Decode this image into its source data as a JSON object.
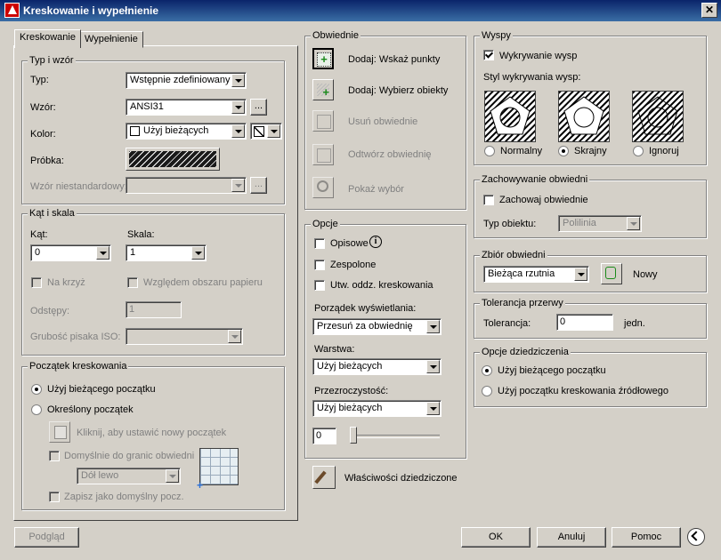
{
  "window": {
    "title": "Kreskowanie i wypełnienie",
    "close_glyph": "✕"
  },
  "tabs": [
    {
      "label": "Kreskowanie"
    },
    {
      "label": "Wypełnienie"
    }
  ],
  "type_pattern": {
    "legend": "Typ i wzór",
    "type_label": "Typ:",
    "type_value": "Wstępnie zdefiniowany",
    "pattern_label": "Wzór:",
    "pattern_value": "ANSI31",
    "browse_label": "...",
    "color_label": "Kolor:",
    "color_value": "Użyj bieżących",
    "swatch_label": "Próbka:",
    "custom_label": "Wzór niestandardowy:",
    "custom_browse": "..."
  },
  "angle_scale": {
    "legend": "Kąt i skala",
    "angle_label": "Kąt:",
    "angle_value": "0",
    "scale_label": "Skala:",
    "scale_value": "1",
    "double_label": "Na krzyż",
    "relative_label": "Względem obszaru papieru",
    "spacing_label": "Odstępy:",
    "spacing_value": "1",
    "iso_label": "Grubość pisaka ISO:"
  },
  "origin": {
    "legend": "Początek kreskowania",
    "current_label": "Użyj bieżącego początku",
    "specified_label": "Określony początek",
    "click_label": "Kliknij, aby ustawić nowy początek",
    "default_boundary_label": "Domyślnie do granic obwiedni",
    "position_value": "Dół lewo",
    "store_label": "Zapisz jako domyślny pocz."
  },
  "boundaries": {
    "legend": "Obwiednie",
    "pick_points": "Dodaj: Wskaż punkty",
    "select_objects": "Dodaj: Wybierz obiekty",
    "remove": "Usuń obwiednie",
    "recreate": "Odtwórz obwiednię",
    "view": "Pokaż wybór"
  },
  "options": {
    "legend": "Opcje",
    "annotative": "Opisowe",
    "associative": "Zespolone",
    "separate": "Utw. oddz. kreskowania",
    "draw_order_label": "Porządek wyświetlania:",
    "draw_order_value": "Przesuń za obwiednię",
    "layer_label": "Warstwa:",
    "layer_value": "Użyj bieżących",
    "transparency_label": "Przezroczystość:",
    "transparency_value": "Użyj bieżących",
    "transparency_number": "0",
    "transparency_level": 0
  },
  "inherit_button": "Właściwości dziedziczone",
  "islands": {
    "legend": "Wyspy",
    "detect_label": "Wykrywanie wysp",
    "style_label": "Styl wykrywania wysp:",
    "normal": "Normalny",
    "outer": "Skrajny",
    "ignore": "Ignoruj"
  },
  "retain": {
    "legend": "Zachowywanie obwiedni",
    "retain_label": "Zachowaj obwiednie",
    "object_type_label": "Typ obiektu:",
    "object_type_value": "Polilinia"
  },
  "boundary_set": {
    "legend": "Zbiór obwiedni",
    "value": "Bieżąca rzutnia",
    "new_label": "Nowy"
  },
  "gap": {
    "legend": "Tolerancja przerwy",
    "label": "Tolerancja:",
    "value": "0",
    "unit": "jedn."
  },
  "inherit_opts": {
    "legend": "Opcje dziedziczenia",
    "current": "Użyj bieżącego początku",
    "source": "Użyj początku kreskowania źródłowego"
  },
  "footer": {
    "preview": "Podgląd",
    "ok": "OK",
    "cancel": "Anuluj",
    "help": "Pomoc"
  }
}
